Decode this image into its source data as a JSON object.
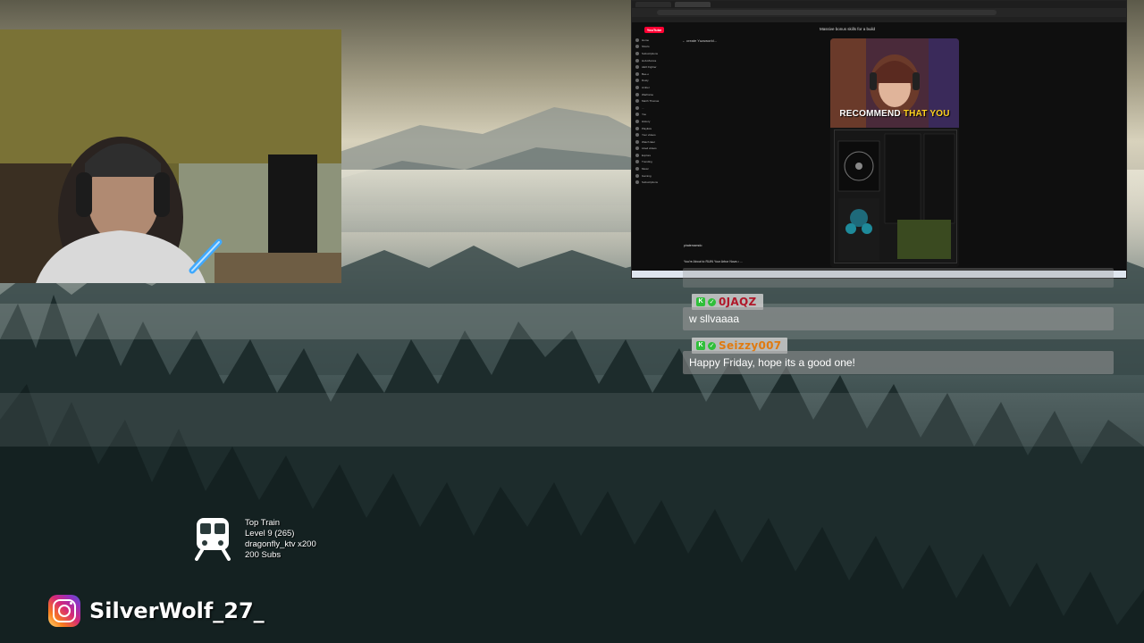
{
  "capture": {
    "page_title": "Massive bonus skills for a build",
    "back_label": "← create Yuzuworld...",
    "logo_text": "YouTube",
    "short_caption_white": "RECOMMEND",
    "short_caption_yellow": "THAT YOU",
    "channel_name": "piratemamdo",
    "video_desc": "You're About to RUIN Your Arbor Nova • ...",
    "sidebar_items": [
      "Home",
      "Shorts",
      "Subscriptions",
      "Hub-Monica",
      "AEO Fighter",
      "Bee-o",
      "Dusty",
      "Amber",
      "Warframe",
      "Marth Thomas",
      "...",
      "You",
      "History",
      "Playlists",
      "Your videos",
      "Watch later",
      "Liked videos",
      "Explore",
      "Trending",
      "Music",
      "Gaming",
      "Subscriptions"
    ]
  },
  "chat": {
    "messages": [
      {
        "username": "0JAQZ",
        "username_color": "#b0182a",
        "text": "w sllvaaaa"
      },
      {
        "username": "Seizzy007",
        "username_color": "#e07a10",
        "text": "Happy Friday, hope its a good one!"
      }
    ]
  },
  "goal": {
    "title": "Top Train",
    "level": "Level 9  (265)",
    "top_user": "dragonfly_ktv x200",
    "subs": "200 Subs"
  },
  "instagram": {
    "handle": "SilverWolf_27_"
  },
  "colors": {
    "broadcaster_badge": "#2fbf3a",
    "youtube_red": "#ff0033",
    "caption_yellow": "#ffd21f"
  },
  "icons": [
    "train-icon",
    "instagram-icon",
    "broadcaster-badge-icon",
    "verified-badge-icon"
  ]
}
